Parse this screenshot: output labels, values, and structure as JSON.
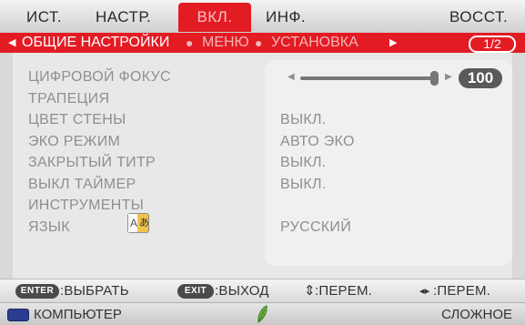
{
  "tabs": [
    {
      "label": "ИСТ."
    },
    {
      "label": "НАСТР."
    },
    {
      "label": "ВКЛ."
    },
    {
      "label": "ИНФ."
    },
    {
      "label": "ВОССТ."
    }
  ],
  "selected_tab": "ВКЛ.",
  "subnav": {
    "left_arrow": "◀",
    "current": "ОБЩИЕ НАСТРОЙКИ",
    "others": [
      "МЕНЮ",
      "УСТАНОВКА"
    ],
    "separator": "●",
    "right_arrow": "▶",
    "page": "1/2"
  },
  "settings": [
    {
      "label": "ЦИФРОВОЙ ФОКУС",
      "value": ""
    },
    {
      "label": "ТРАПЕЦИЯ",
      "value": ""
    },
    {
      "label": "ЦВЕТ СТЕНЫ",
      "value": "ВЫКЛ."
    },
    {
      "label": "ЭКО РЕЖИМ",
      "value": "АВТО ЭКО"
    },
    {
      "label": "ЗАКРЫТЫЙ ТИТР",
      "value": "ВЫКЛ."
    },
    {
      "label": "ВЫКЛ ТАЙМЕР",
      "value": "ВЫКЛ."
    },
    {
      "label": "ИНСТРУМЕНТЫ",
      "value": ""
    },
    {
      "label": "ЯЗЫК",
      "value": "РУССКИЙ"
    }
  ],
  "digital_focus": {
    "value": "100",
    "level": 1.0,
    "left_arrow": "◀",
    "right_arrow": "▶"
  },
  "language_icon_glyphs": {
    "a": "A",
    "b": "あ"
  },
  "hints": [
    {
      "key": "ENTER",
      "text": ":ВЫБРАТЬ"
    },
    {
      "key": "EXIT",
      "text": ":ВЫХОД"
    },
    {
      "key": "⇕",
      "text": ":ПЕРЕМ."
    },
    {
      "key": "◂▸",
      "text": ":ПЕРЕМ."
    }
  ],
  "status": {
    "source": "КОМПЬЮТЕР",
    "mode": "СЛОЖНОЕ"
  },
  "colors": {
    "accent": "#e31b23",
    "panel": "#e8e8e8",
    "text_dim": "#8f8f8f",
    "source_icon": "#2b3d8f",
    "eco_leaf": "#6db33f"
  },
  "icons": {
    "language": "language-icon",
    "source": "monitor-icon",
    "eco": "eco-leaf-icon"
  }
}
